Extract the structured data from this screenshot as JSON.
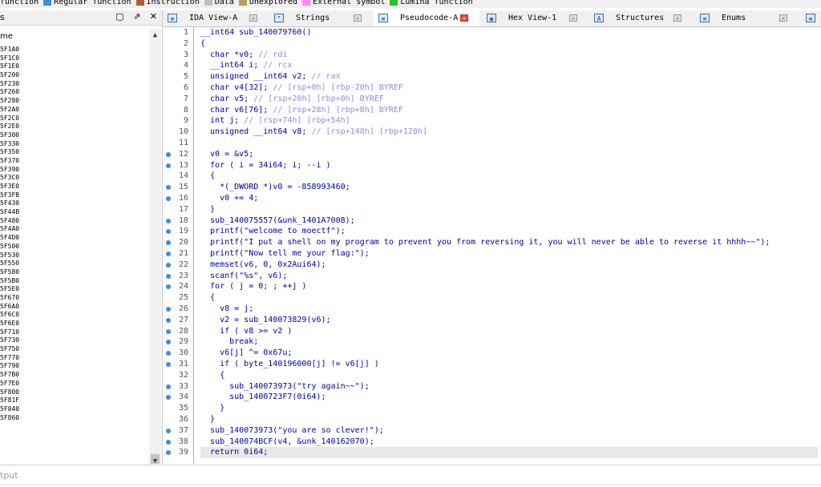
{
  "legend": [
    {
      "label": "function",
      "color": "#ffffff"
    },
    {
      "label": "Regular function",
      "color": "#3c8fd9"
    },
    {
      "label": "Instruction",
      "color": "#b05a3c"
    },
    {
      "label": "Data",
      "color": "#bfbfbf"
    },
    {
      "label": "Unexplored",
      "color": "#b0a060"
    },
    {
      "label": "External symbol",
      "color": "#ff88ff"
    },
    {
      "label": "Lumina function",
      "color": "#2bc12b"
    }
  ],
  "functions_panel": {
    "title": "s",
    "column_header": "me",
    "controls": [
      "▢",
      "⇗",
      "✕"
    ],
    "items": [
      "5F1A0",
      "5F1C0",
      "5F1E0",
      "5F200",
      "5F230",
      "5F260",
      "5F280",
      "5F2A0",
      "5F2C0",
      "5F2E0",
      "5F300",
      "5F330",
      "5F350",
      "5F370",
      "5F390",
      "5F3C0",
      "5F3E0",
      "5F3FB",
      "5F430",
      "5F44B",
      "5F480",
      "5F4A0",
      "5F4D0",
      "5F500",
      "5F530",
      "5F550",
      "5F580",
      "5F5B0",
      "5F5E0",
      "5F670",
      "5F6A0",
      "5F6C0",
      "5F6E0",
      "5F710",
      "5F730",
      "5F750",
      "5F770",
      "5F790",
      "5F7B0",
      "5F7E0",
      "5F800",
      "5F81F",
      "5F840",
      "5F860"
    ]
  },
  "tabs": [
    {
      "icon": "≡",
      "label": "IDA View-A",
      "active": false
    },
    {
      "icon": "\"",
      "label": "Strings",
      "active": false
    },
    {
      "icon": "≡",
      "label": "Pseudocode-A",
      "active": true
    },
    {
      "icon": "◉",
      "label": "Hex View-1",
      "active": false
    },
    {
      "icon": "A",
      "label": "Structures",
      "active": false
    },
    {
      "icon": "≡",
      "label": "Enums",
      "active": false
    },
    {
      "icon": "≡",
      "label": "",
      "active": false
    }
  ],
  "code_lines": [
    {
      "n": 1,
      "dot": false,
      "text": "__int64 sub_140079760()",
      "comment": ""
    },
    {
      "n": 2,
      "dot": false,
      "text": "{",
      "comment": ""
    },
    {
      "n": 3,
      "dot": false,
      "text": "  char *v0; ",
      "comment": "// rdi"
    },
    {
      "n": 4,
      "dot": false,
      "text": "  __int64 i; ",
      "comment": "// rcx"
    },
    {
      "n": 5,
      "dot": false,
      "text": "  unsigned __int64 v2; ",
      "comment": "// rax"
    },
    {
      "n": 6,
      "dot": false,
      "text": "  char v4[32]; ",
      "comment": "// [rsp+0h] [rbp-20h] BYREF"
    },
    {
      "n": 7,
      "dot": false,
      "text": "  char v5; ",
      "comment": "// [rsp+20h] [rbp+0h] BYREF"
    },
    {
      "n": 8,
      "dot": false,
      "text": "  char v6[76]; ",
      "comment": "// [rsp+28h] [rbp+8h] BYREF"
    },
    {
      "n": 9,
      "dot": false,
      "text": "  int j; ",
      "comment": "// [rsp+74h] [rbp+54h]"
    },
    {
      "n": 10,
      "dot": false,
      "text": "  unsigned __int64 v8; ",
      "comment": "// [rsp+148h] [rbp+128h]"
    },
    {
      "n": 11,
      "dot": false,
      "text": "",
      "comment": ""
    },
    {
      "n": 12,
      "dot": true,
      "text": "  v0 = &v5;",
      "comment": ""
    },
    {
      "n": 13,
      "dot": true,
      "text": "  for ( i = 34i64; i; --i )",
      "comment": ""
    },
    {
      "n": 14,
      "dot": false,
      "text": "  {",
      "comment": ""
    },
    {
      "n": 15,
      "dot": true,
      "text": "    *(_DWORD *)v0 = -858993460;",
      "comment": ""
    },
    {
      "n": 16,
      "dot": true,
      "text": "    v0 += 4;",
      "comment": ""
    },
    {
      "n": 17,
      "dot": false,
      "text": "  }",
      "comment": ""
    },
    {
      "n": 18,
      "dot": true,
      "text": "  sub_140075557(&unk_1401A7008);",
      "comment": ""
    },
    {
      "n": 19,
      "dot": true,
      "text": "  printf(\"welcome to moectf\");",
      "comment": ""
    },
    {
      "n": 20,
      "dot": true,
      "text": "  printf(\"I put a shell on my program to prevent you from reversing it, you will never be able to reverse it hhhh~~\");",
      "comment": ""
    },
    {
      "n": 21,
      "dot": true,
      "text": "  printf(\"Now tell me your flag:\");",
      "comment": ""
    },
    {
      "n": 22,
      "dot": true,
      "text": "  memset(v6, 0, 0x2Aui64);",
      "comment": ""
    },
    {
      "n": 23,
      "dot": true,
      "text": "  scanf(\"%s\", v6);",
      "comment": ""
    },
    {
      "n": 24,
      "dot": true,
      "text": "  for ( j = 0; ; ++j )",
      "comment": ""
    },
    {
      "n": 25,
      "dot": false,
      "text": "  {",
      "comment": ""
    },
    {
      "n": 26,
      "dot": true,
      "text": "    v8 = j;",
      "comment": ""
    },
    {
      "n": 27,
      "dot": true,
      "text": "    v2 = sub_140073829(v6);",
      "comment": ""
    },
    {
      "n": 28,
      "dot": true,
      "text": "    if ( v8 >= v2 )",
      "comment": ""
    },
    {
      "n": 29,
      "dot": true,
      "text": "      break;",
      "comment": ""
    },
    {
      "n": 30,
      "dot": true,
      "text": "    v6[j] ^= 0x67u;",
      "comment": ""
    },
    {
      "n": 31,
      "dot": true,
      "text": "    if ( byte_140196000[j] != v6[j] )",
      "comment": ""
    },
    {
      "n": 32,
      "dot": false,
      "text": "    {",
      "comment": ""
    },
    {
      "n": 33,
      "dot": true,
      "text": "      sub_140073973(\"try again~~\");",
      "comment": ""
    },
    {
      "n": 34,
      "dot": true,
      "text": "      sub_1400723F7(0i64);",
      "comment": ""
    },
    {
      "n": 35,
      "dot": false,
      "text": "    }",
      "comment": ""
    },
    {
      "n": 36,
      "dot": false,
      "text": "  }",
      "comment": ""
    },
    {
      "n": 37,
      "dot": true,
      "text": "  sub_140073973(\"you are so clever!\");",
      "comment": ""
    },
    {
      "n": 38,
      "dot": true,
      "text": "  sub_140074BCF(v4, &unk_140162070);",
      "comment": ""
    },
    {
      "n": 39,
      "dot": true,
      "text": "  return 0i64;",
      "comment": ""
    }
  ],
  "highlighted_line": 39,
  "output": {
    "label": "tput"
  }
}
